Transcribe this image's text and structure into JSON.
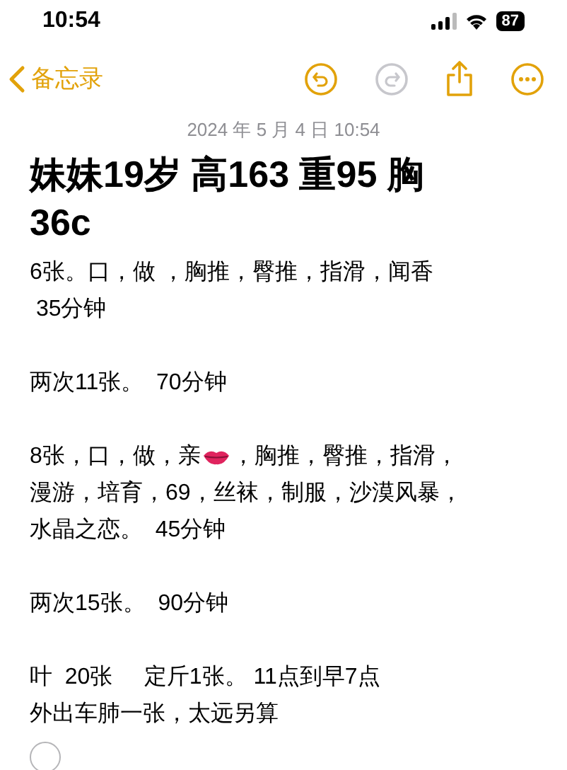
{
  "status_bar": {
    "time": "10:54",
    "battery": "87"
  },
  "nav": {
    "back_label": "备忘录",
    "redo_disabled": true
  },
  "note": {
    "date": "2024 年 5 月 4 日 10:54",
    "title": "妹妹19岁 高163 重95 胸36c",
    "paragraphs": [
      {
        "lines": [
          [
            {
              "kind": "text",
              "text": "6张。口，做 ，胸推，臀推，指滑，闻香"
            }
          ],
          [
            {
              "kind": "text",
              "text": " 35分钟"
            }
          ]
        ]
      },
      {
        "lines": [
          [
            {
              "kind": "text",
              "text": "两次11张。  70分钟"
            }
          ]
        ]
      },
      {
        "lines": [
          [
            {
              "kind": "text",
              "text": "8张，口，做，亲"
            },
            {
              "kind": "lips"
            },
            {
              "kind": "text",
              "text": "，胸推，臀推，指滑，"
            }
          ],
          [
            {
              "kind": "text",
              "text": "漫游，培育，69，丝袜，制服，沙漠风暴，"
            }
          ],
          [
            {
              "kind": "text",
              "text": "水晶之恋。  45分钟"
            }
          ]
        ]
      },
      {
        "lines": [
          [
            {
              "kind": "text",
              "text": "两次15张。  90分钟"
            }
          ]
        ]
      },
      {
        "lines": [
          [
            {
              "kind": "text",
              "text": "叶  20张     定斤1张。 11点到早7点"
            }
          ],
          [
            {
              "kind": "text",
              "text": "外出车肺一张，太远另算"
            }
          ]
        ]
      }
    ],
    "checklist_item": {
      "checked": false
    }
  }
}
